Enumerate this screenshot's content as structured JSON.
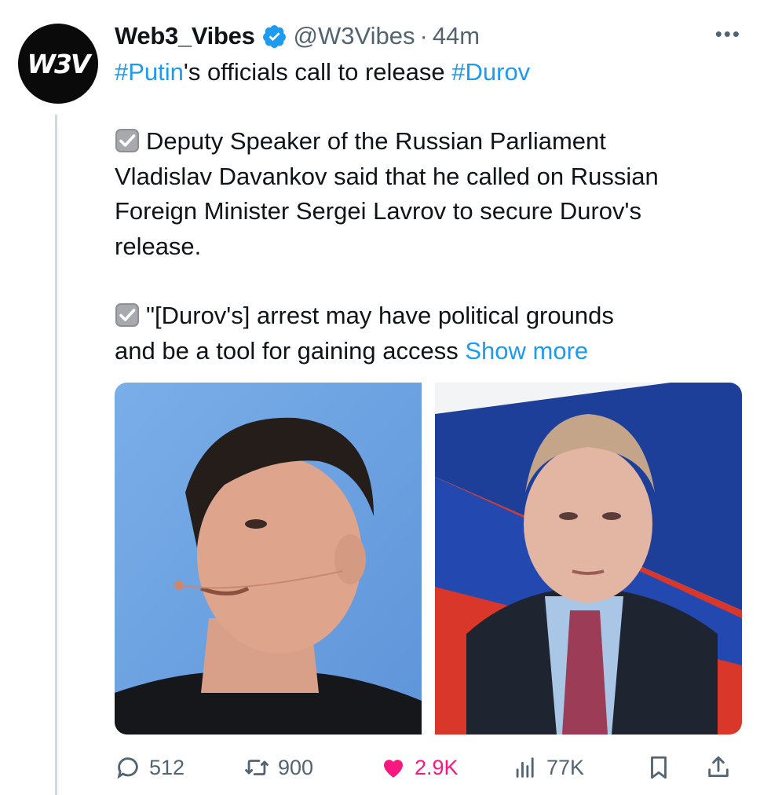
{
  "author": {
    "avatar_text": "W3V",
    "display_name": "Web3_Vibes",
    "handle": "@W3Vibes",
    "separator": "·",
    "time": "44m",
    "verified_icon": "verified-badge-icon"
  },
  "tweet": {
    "line1": {
      "tag1": "#Putin",
      "text1": "'s officials call to release ",
      "tag2": "#Durov"
    },
    "para1": [
      "Deputy Speaker of the Russian Parliament",
      "Vladislav Davankov said that he called on Russian",
      "Foreign Minister Sergei Lavrov to secure Durov's",
      "release."
    ],
    "para2": [
      "\"[Durov's] arrest may have political grounds",
      "and be a tool for gaining access "
    ],
    "show_more": "Show more",
    "check_icon": "ballot-box-with-check-icon"
  },
  "media": [
    {
      "name": "durov-photo"
    },
    {
      "name": "putin-photo"
    }
  ],
  "actions": {
    "replies": "512",
    "reposts": "900",
    "likes": "2.9K",
    "views": "77K"
  },
  "colors": {
    "link": "#1d9bf0",
    "muted": "#536471",
    "like": "#f91880",
    "verified": "#1d9bf0"
  }
}
